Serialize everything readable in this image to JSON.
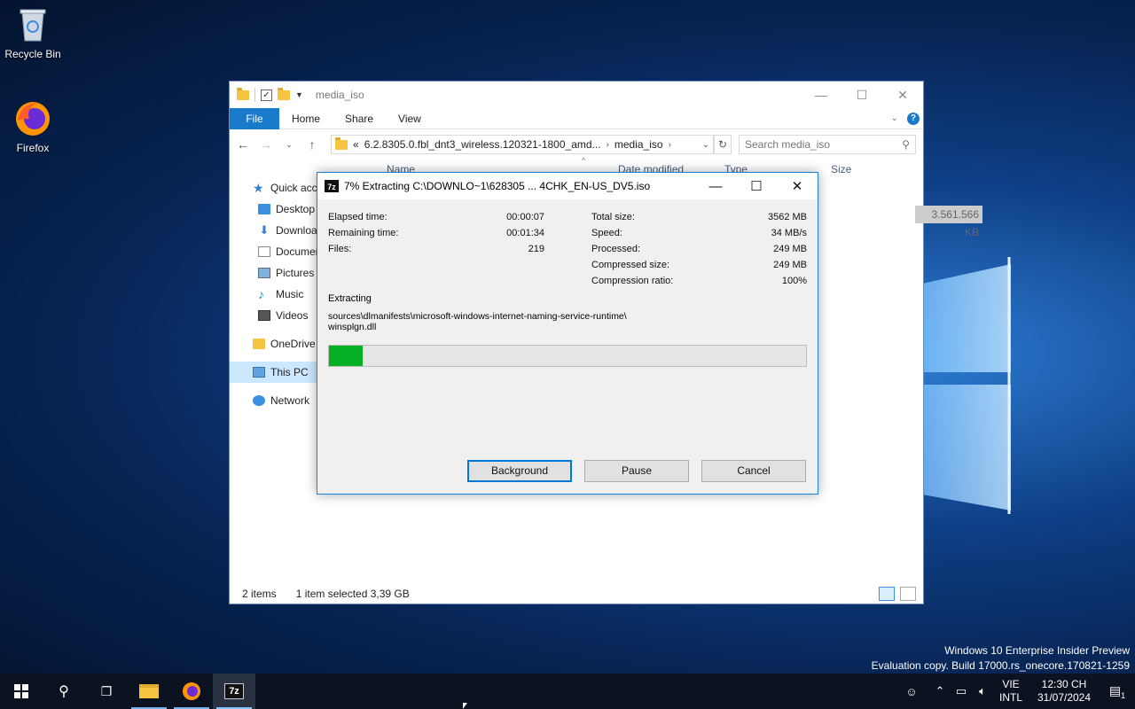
{
  "desktop": {
    "recycle_bin_label": "Recycle Bin",
    "firefox_label": "Firefox",
    "watermark_line1": "Windows 10 Enterprise Insider Preview",
    "watermark_line2": "Evaluation copy. Build 17000.rs_onecore.170821-1259"
  },
  "explorer": {
    "title": "media_iso",
    "ribbon_tabs": [
      "File",
      "Home",
      "Share",
      "View"
    ],
    "address": {
      "prefix": "«",
      "crumb1": "6.2.8305.0.fbl_dnt3_wireless.120321-1800_amd...",
      "crumb2": "media_iso"
    },
    "search_placeholder": "Search media_iso",
    "columns": [
      "Name",
      "Date modified",
      "Type",
      "Size"
    ],
    "size_value": "3.561.566 KB",
    "nav": {
      "quick_access": "Quick access",
      "desktop": "Desktop",
      "downloads": "Downloads",
      "documents": "Documents",
      "pictures": "Pictures",
      "music": "Music",
      "videos": "Videos",
      "onedrive": "OneDrive",
      "this_pc": "This PC",
      "network": "Network"
    },
    "status": {
      "items": "2 items",
      "selected": "1 item selected  3,39 GB"
    }
  },
  "dialog": {
    "title": "7% Extracting C:\\DOWNLO~1\\628305 ... 4CHK_EN-US_DV5.iso",
    "icon_text": "7z",
    "left_stats": [
      {
        "label": "Elapsed time:",
        "value": "00:00:07"
      },
      {
        "label": "Remaining time:",
        "value": "00:01:34"
      },
      {
        "label": "Files:",
        "value": "219"
      }
    ],
    "right_stats": [
      {
        "label": "Total size:",
        "value": "3562 MB"
      },
      {
        "label": "Speed:",
        "value": "34 MB/s"
      },
      {
        "label": "Processed:",
        "value": "249 MB"
      },
      {
        "label": "Compressed size:",
        "value": "249 MB"
      },
      {
        "label": "Compression ratio:",
        "value": "100%"
      }
    ],
    "status_label": "Extracting",
    "path_line1": "sources\\dlmanifests\\microsoft-windows-internet-naming-service-runtime\\",
    "path_line2": "winsplgn.dll",
    "progress_fraction": 0.07,
    "buttons": {
      "background": "Background",
      "pause": "Pause",
      "cancel": "Cancel"
    }
  },
  "taskbar": {
    "seven_zip_label": "7z",
    "lang_line1": "VIE",
    "lang_line2": "INTL",
    "time": "12:30 CH",
    "date": "31/07/2024",
    "notification_count": "1"
  },
  "colors": {
    "progress_fill": "#06b025",
    "accent": "#0078d7",
    "file_tab": "#1979ca"
  }
}
